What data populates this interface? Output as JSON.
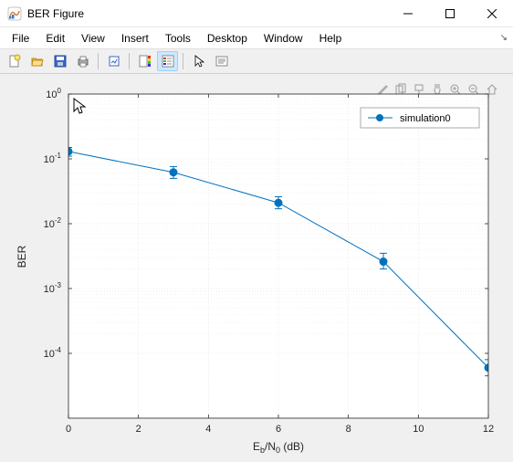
{
  "window": {
    "title": "BER Figure"
  },
  "menus": [
    "File",
    "Edit",
    "View",
    "Insert",
    "Tools",
    "Desktop",
    "Window",
    "Help"
  ],
  "toolbar_icons": [
    "new-figure",
    "open",
    "save",
    "print",
    "link-data",
    "colorbar",
    "legend",
    "cursor",
    "insert-box"
  ],
  "axes_toolbar_icons": [
    "brush",
    "copy",
    "datatip",
    "pan",
    "zoom-in",
    "zoom-out",
    "home"
  ],
  "chart_data": {
    "type": "line",
    "xlabel_html": "E<tspan baseline-shift='-3' font-size='9'>b</tspan>/N<tspan baseline-shift='-3' font-size='9'>0</tspan> (dB)",
    "xlabel": "Eb/N0 (dB)",
    "ylabel": "BER",
    "xlim": [
      0,
      12
    ],
    "ylim": [
      1e-05,
      1
    ],
    "xticks": [
      0,
      2,
      4,
      6,
      8,
      10,
      12
    ],
    "yticks_exp": [
      0,
      -1,
      -2,
      -3,
      -4
    ],
    "legend": {
      "label": "simulation0"
    },
    "series": [
      {
        "name": "simulation0",
        "x": [
          0,
          3,
          6,
          9,
          12
        ],
        "y": [
          0.13,
          0.062,
          0.021,
          0.0026,
          6e-05
        ],
        "yerr_low": [
          0.11,
          0.05,
          0.017,
          0.002,
          4.5e-05
        ],
        "yerr_high": [
          0.15,
          0.076,
          0.026,
          0.0035,
          8e-05
        ]
      }
    ]
  }
}
